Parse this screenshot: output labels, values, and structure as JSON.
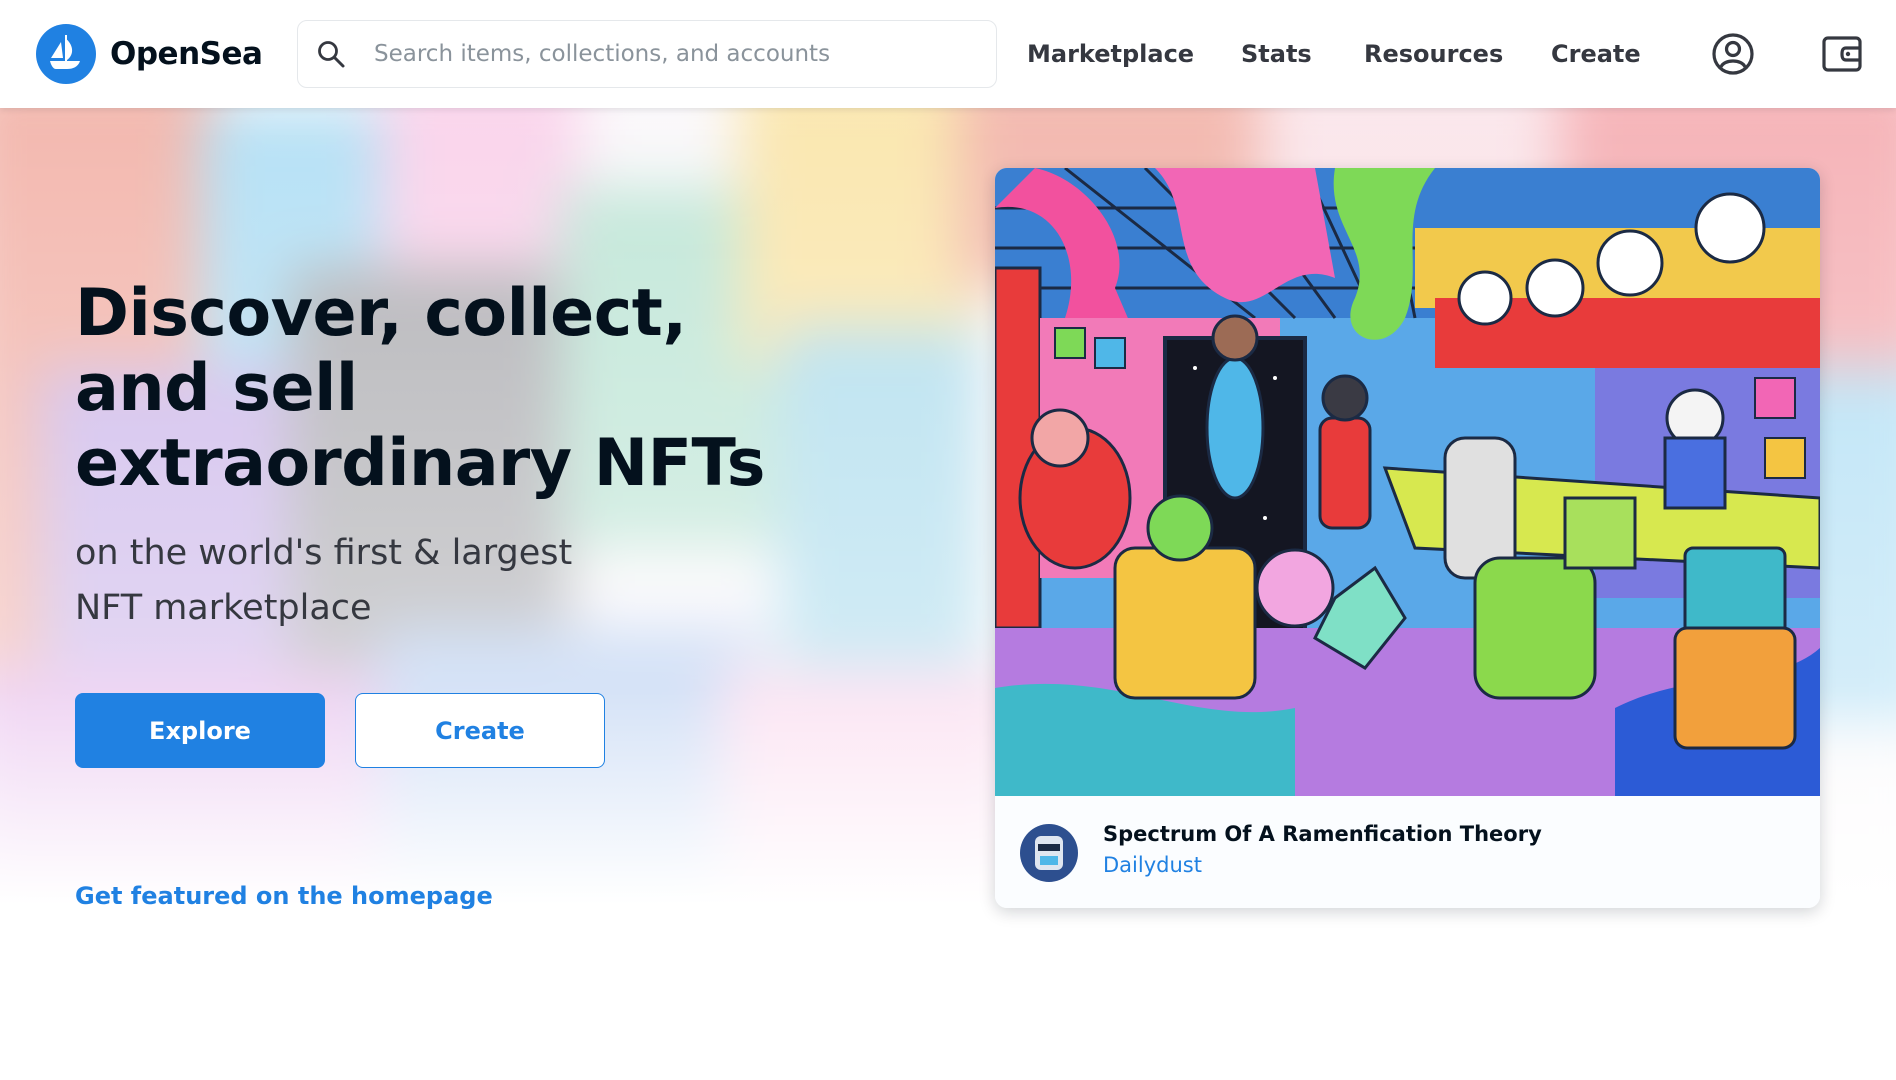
{
  "brand": {
    "name": "OpenSea",
    "accent": "#2081e2"
  },
  "search": {
    "placeholder": "Search items, collections, and accounts",
    "value": ""
  },
  "nav": {
    "items": [
      {
        "label": "Marketplace"
      },
      {
        "label": "Stats"
      },
      {
        "label": "Resources"
      },
      {
        "label": "Create"
      }
    ],
    "icons": [
      "account-icon",
      "wallet-icon"
    ]
  },
  "hero": {
    "title": "Discover, collect, and sell extraordinary NFTs",
    "subtitle": "on the world's first & largest NFT marketplace",
    "explore_label": "Explore",
    "create_label": "Create",
    "featured_link": "Get featured on the homepage"
  },
  "featured": {
    "title": "Spectrum Of A Ramenfication Theory",
    "author": "Dailydust"
  }
}
